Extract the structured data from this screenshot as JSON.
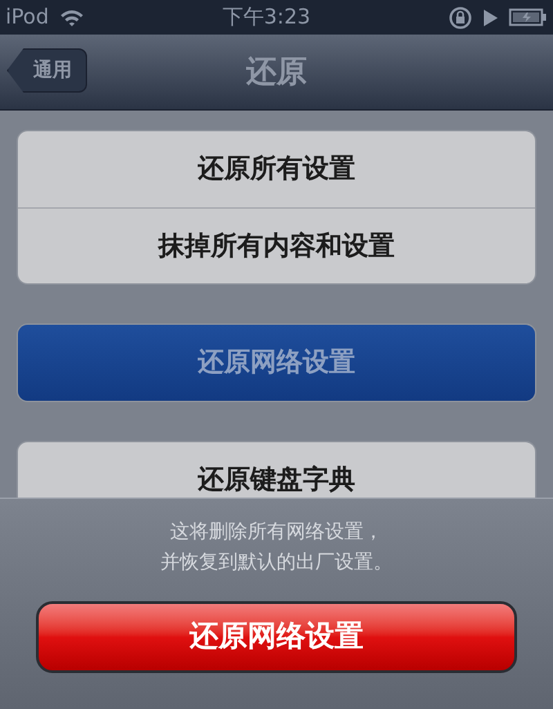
{
  "status_bar": {
    "carrier": "iPod",
    "time": "下午3:23"
  },
  "nav_bar": {
    "back_button": "通用",
    "title": "还原"
  },
  "groups": [
    {
      "items": [
        {
          "label": "还原所有设置",
          "selected": false
        },
        {
          "label": "抹掉所有内容和设置",
          "selected": false
        }
      ]
    },
    {
      "items": [
        {
          "label": "还原网络设置",
          "selected": true
        }
      ]
    },
    {
      "items": [
        {
          "label": "还原键盘字典",
          "selected": false
        }
      ]
    }
  ],
  "action_sheet": {
    "message": [
      "这将删除所有网络设置，",
      "并恢复到默认的出厂设置。"
    ],
    "button": "还原网络设置"
  }
}
